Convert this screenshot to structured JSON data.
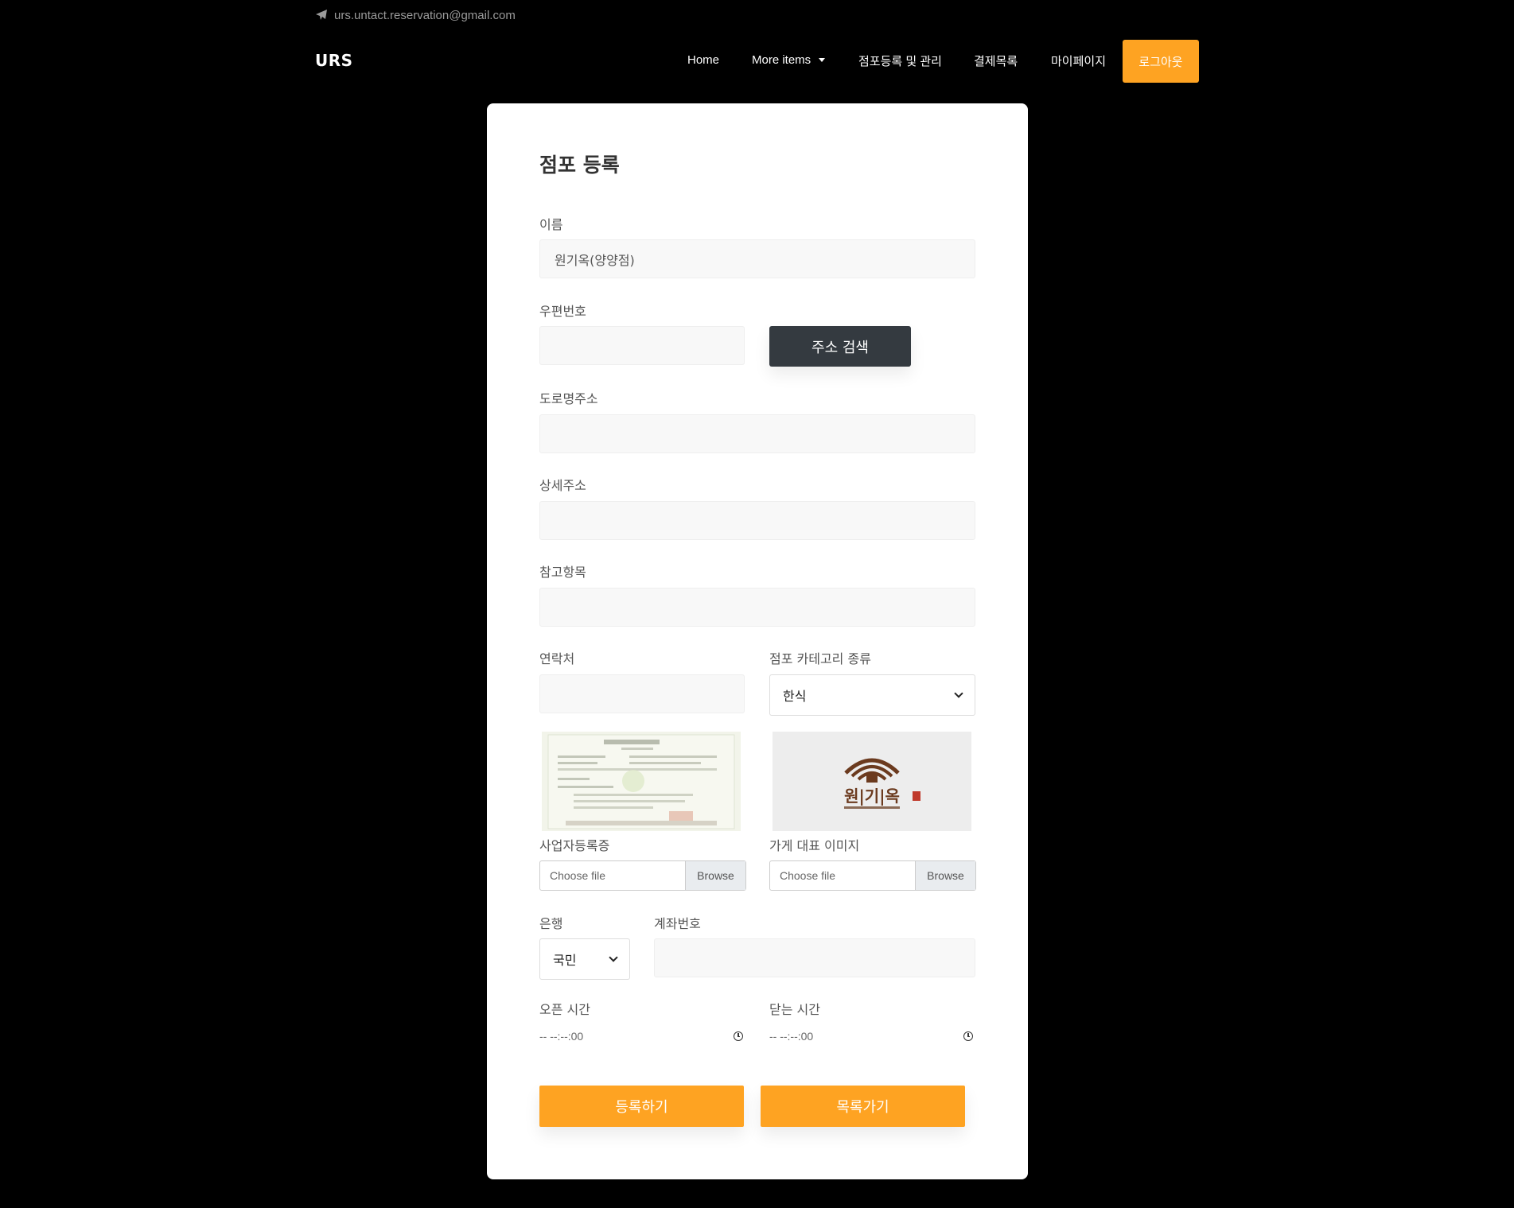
{
  "topbar": {
    "email": "urs.untact.reservation@gmail.com"
  },
  "navbar": {
    "brand": "URS",
    "items": {
      "home": "Home",
      "more": "More items",
      "store": "점포등록 및 관리",
      "payments": "결제목록",
      "mypage": "마이페이지"
    },
    "logout": "로그아웃"
  },
  "form": {
    "title": "점포 등록",
    "name": {
      "label": "이름",
      "value": "원기옥(양양점)"
    },
    "zipcode": {
      "label": "우편번호",
      "value": ""
    },
    "search_button": "주소 검색",
    "road_address": {
      "label": "도로명주소",
      "value": ""
    },
    "detail_address": {
      "label": "상세주소",
      "value": ""
    },
    "reference": {
      "label": "참고항목",
      "value": ""
    },
    "contact": {
      "label": "연락처",
      "value": ""
    },
    "category": {
      "label": "점포 카테고리 종류",
      "selected": "한식"
    },
    "business_license": {
      "label": "사업자등록증",
      "choose": "Choose file",
      "browse": "Browse"
    },
    "store_image": {
      "label": "가게 대표 이미지",
      "choose": "Choose file",
      "browse": "Browse",
      "logo_text": "원|기|옥"
    },
    "bank": {
      "label": "은행",
      "selected": "국민"
    },
    "account": {
      "label": "계좌번호",
      "value": ""
    },
    "open_time": {
      "label": "오픈 시간",
      "value": "-- --:--:00"
    },
    "close_time": {
      "label": "닫는 시간",
      "value": "-- --:--:00"
    },
    "submit": "등록하기",
    "to_list": "목록가기"
  },
  "colors": {
    "accent": "#fea322",
    "dark_button": "#343a40",
    "background": "#000000",
    "card": "#ffffff"
  }
}
